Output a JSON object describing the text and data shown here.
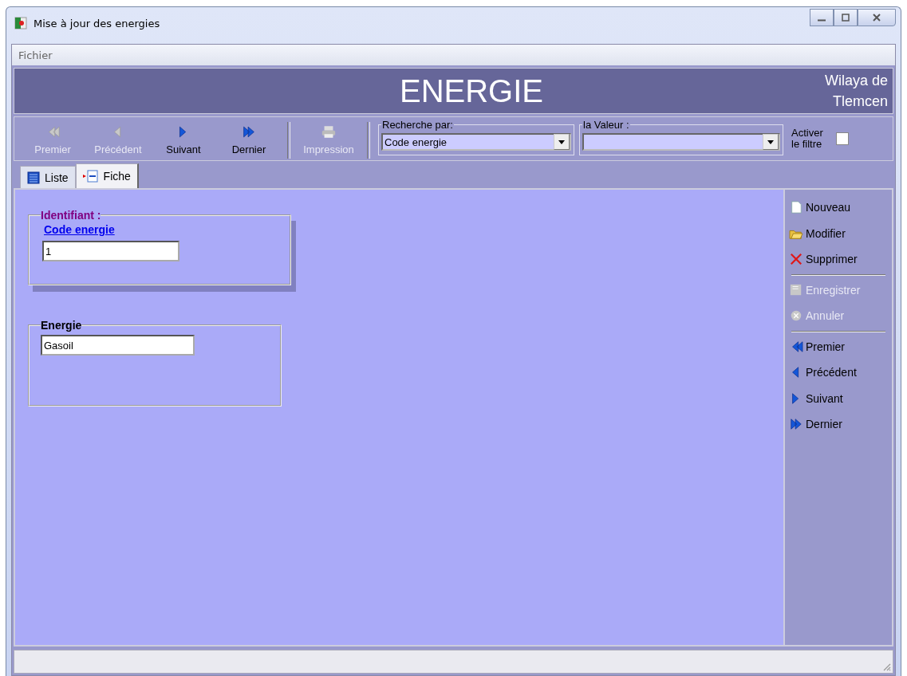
{
  "window": {
    "title": "Mise à jour des energies"
  },
  "menu": [
    "Fichier"
  ],
  "header": {
    "title": "ENERGIE",
    "subtitle_lines": [
      "Wilaya de",
      "Tlemcen"
    ]
  },
  "toolbar": [
    {
      "label": "Premier",
      "kind": "first",
      "disabled": true
    },
    {
      "label": "Précédent",
      "kind": "prev",
      "disabled": true
    },
    {
      "label": "Suivant",
      "kind": "next",
      "disabled": false
    },
    {
      "label": "Dernier",
      "kind": "last",
      "disabled": false
    },
    {
      "label": "Impression",
      "kind": "print",
      "disabled": true
    }
  ],
  "search": {
    "by_label": "Recherche par:",
    "by_value": "Code energie",
    "value_label": "la Valeur :",
    "filter_label": "Activer le filtre",
    "filter_checked": false
  },
  "tabs": [
    {
      "label": "Liste",
      "kind": "list",
      "selected": false
    },
    {
      "label": "Fiche",
      "kind": "form",
      "selected": true
    }
  ],
  "identifiant": {
    "legend": "Identifiant :",
    "link": "Code energie",
    "value": "1"
  },
  "energie": {
    "legend": "Energie",
    "value": "Gasoil"
  },
  "side_groups": [
    [
      {
        "label": "Nouveau",
        "kind": "new",
        "disabled": false
      },
      {
        "label": "Modifier",
        "kind": "edit",
        "disabled": false
      },
      {
        "label": "Supprimer",
        "kind": "delete",
        "disabled": false
      }
    ],
    [
      {
        "label": "Enregistrer",
        "kind": "save",
        "disabled": true
      },
      {
        "label": "Annuler",
        "kind": "cancel",
        "disabled": true
      }
    ],
    [
      {
        "label": "Premier",
        "kind": "first",
        "disabled": false
      },
      {
        "label": "Précédent",
        "kind": "prev",
        "disabled": false
      },
      {
        "label": "Suivant",
        "kind": "next",
        "disabled": false
      },
      {
        "label": "Dernier",
        "kind": "last",
        "disabled": false
      }
    ]
  ]
}
